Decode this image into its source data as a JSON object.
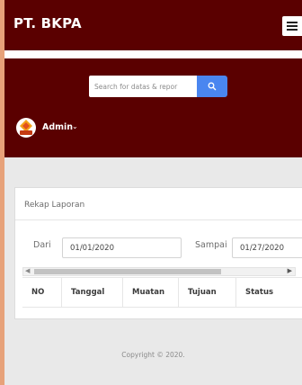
{
  "header": {
    "brand": "PT. BKPA"
  },
  "search": {
    "placeholder": "Search for datas & repor"
  },
  "user": {
    "name": "Admin",
    "caret": "⌄"
  },
  "report": {
    "title": "Rekap Laporan",
    "from_label": "Dari",
    "from_value": "01/01/2020",
    "to_label": "Sampai",
    "to_value": "01/27/2020",
    "columns": [
      "NO",
      "Tanggal",
      "Muatan",
      "Tujuan",
      "Status"
    ]
  },
  "footer": {
    "copyright": "Copyright © 2020."
  },
  "colors": {
    "primary": "#5a0000",
    "accent": "#4a86f0",
    "background": "#e9e9e9"
  }
}
